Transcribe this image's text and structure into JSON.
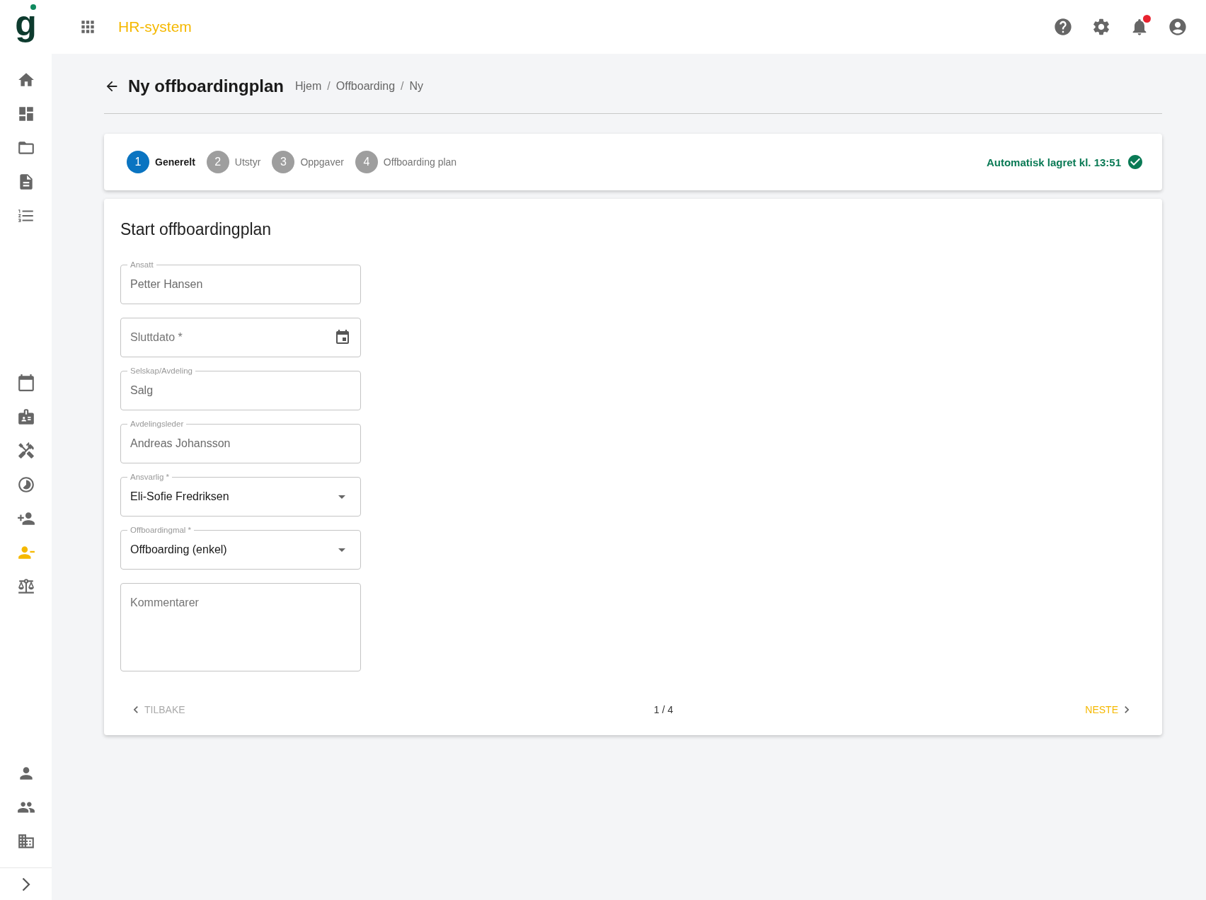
{
  "logo": {
    "text": "g"
  },
  "app_title": "HR-system",
  "notifications": {
    "unread": true
  },
  "sidebar": {
    "top_items": [
      {
        "selected": false
      },
      {
        "selected": false
      },
      {
        "selected": false
      },
      {
        "selected": false
      },
      {
        "selected": false
      }
    ],
    "middle_items": [
      {
        "selected": false
      },
      {
        "selected": false
      },
      {
        "selected": false
      },
      {
        "selected": false
      },
      {
        "selected": false
      },
      {
        "selected": true
      },
      {
        "selected": false
      }
    ],
    "bottom_items": [
      {
        "selected": false
      },
      {
        "selected": false
      },
      {
        "selected": false
      }
    ]
  },
  "page": {
    "title": "Ny offboardingplan",
    "breadcrumb": [
      {
        "kind": "link",
        "text": "Hjem"
      },
      {
        "kind": "separator",
        "text": "/"
      },
      {
        "kind": "link",
        "text": "Offboarding"
      },
      {
        "kind": "separator",
        "text": "/"
      },
      {
        "kind": "link",
        "text": "Ny"
      }
    ]
  },
  "stepper": {
    "steps": [
      {
        "number": "1",
        "label": "Generelt",
        "selected": true
      },
      {
        "number": "2",
        "label": "Utstyr",
        "selected": false
      },
      {
        "number": "3",
        "label": "Oppgaver",
        "selected": false
      },
      {
        "number": "4",
        "label": "Offboarding plan",
        "selected": false
      }
    ],
    "autosave": "Automatisk lagret kl. 13:51"
  },
  "form": {
    "title": "Start offboardingplan",
    "fields": [
      {
        "kind": "text",
        "label": "Ansatt",
        "value": "Petter Hansen",
        "disabled": true
      },
      {
        "kind": "date",
        "placeholder": "Sluttdato *"
      },
      {
        "kind": "text",
        "label": "Selskap/Avdeling",
        "value": "Salg",
        "disabled": true
      },
      {
        "kind": "text",
        "label": "Avdelingsleder",
        "value": "Andreas Johansson",
        "disabled": true
      },
      {
        "kind": "select",
        "label": "Ansvarlig *",
        "value": "Eli-Sofie Fredriksen"
      },
      {
        "kind": "select",
        "label": "Offboardingmal *",
        "value": "Offboarding (enkel)"
      },
      {
        "kind": "textarea",
        "placeholder": "Kommentarer"
      }
    ]
  },
  "pagination": {
    "back": {
      "label": "TILBAKE",
      "disabled": true
    },
    "counter": "1 / 4",
    "next": {
      "label": "NESTE",
      "disabled": false
    }
  }
}
